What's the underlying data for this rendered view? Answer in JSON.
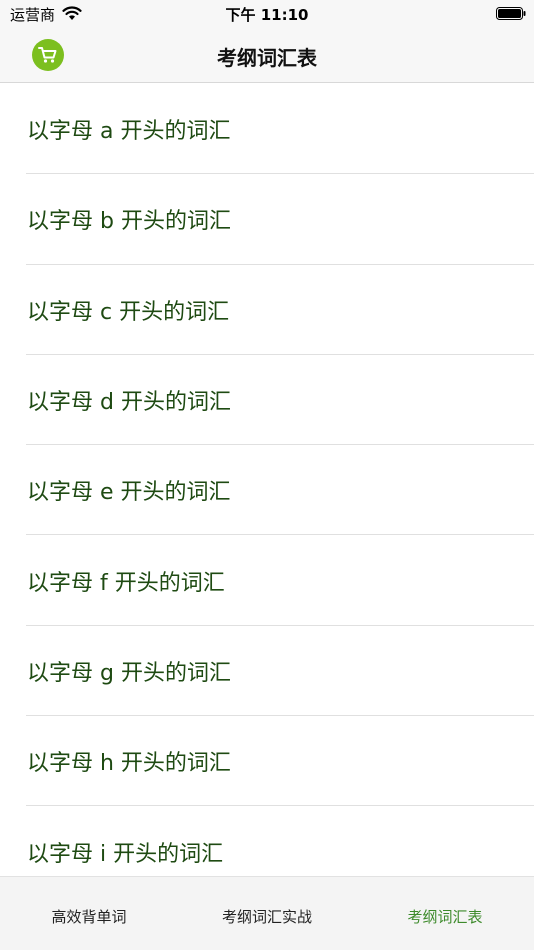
{
  "status_bar": {
    "carrier": "运营商",
    "time": "下午 11:10"
  },
  "nav": {
    "title": "考纲词汇表",
    "left_icon": "cart-icon",
    "accent_color": "#7cbf1f"
  },
  "list": {
    "items": [
      {
        "label": "以字母 a 开头的词汇"
      },
      {
        "label": "以字母 b 开头的词汇"
      },
      {
        "label": "以字母 c 开头的词汇"
      },
      {
        "label": "以字母 d 开头的词汇"
      },
      {
        "label": "以字母 e 开头的词汇"
      },
      {
        "label": "以字母 f 开头的词汇"
      },
      {
        "label": "以字母 g 开头的词汇"
      },
      {
        "label": "以字母 h 开头的词汇"
      },
      {
        "label": "以字母 i 开头的词汇"
      }
    ],
    "text_color": "#1e4a12"
  },
  "tab_bar": {
    "tabs": [
      {
        "label": "高效背单词",
        "active": false
      },
      {
        "label": "考纲词汇实战",
        "active": false
      },
      {
        "label": "考纲词汇表",
        "active": true
      }
    ],
    "active_color": "#3d8a2b"
  }
}
